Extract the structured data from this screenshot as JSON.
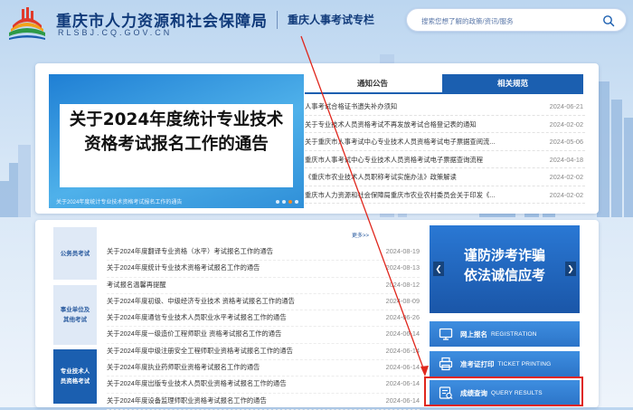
{
  "header": {
    "site_title": "重庆市人力资源和社会保障局",
    "site_url": "RLSBJ.CQ.GOV.CN",
    "section_title": "重庆人事考试专栏",
    "search_placeholder": "搜索您想了解的政策/资讯/服务"
  },
  "banner": {
    "headline": "关于2024年度统计专业技术资格考试报名工作的通告",
    "caption": "关于2024年度统计专业技术资格考试报名工作的通告"
  },
  "tabs": [
    {
      "label": "通知公告"
    },
    {
      "label": "相关规范"
    }
  ],
  "news": [
    {
      "title": "人事考试合格证书遗失补办须知",
      "date": "2024-06-21"
    },
    {
      "title": "关于专业技术人员资格考试不再发放考试合格登记表的通知",
      "date": "2024-02-02"
    },
    {
      "title": "关于重庆市人事考试中心专业技术人员资格考试电子票据查阅流...",
      "date": "2024-05-06"
    },
    {
      "title": "重庆市人事考试中心专业技术人员资格考试电子票据查询流程",
      "date": "2024-04-18"
    },
    {
      "title": "《重庆市农业技术人员职称考试实施办法》政策解读",
      "date": "2024-02-02"
    },
    {
      "title": "重庆市人力资源和社会保障局重庆市农业农村委员会关于印发《...",
      "date": "2024-02-02"
    }
  ],
  "categories": [
    {
      "label": "公务员考试"
    },
    {
      "label": "事业单位及其他考试"
    },
    {
      "label": "专业技术人员资格考试"
    }
  ],
  "more_label": "更多>>",
  "list": [
    {
      "title": "关于2024年度翻译专业资格（水平）考试报名工作的通告",
      "date": "2024-08-19"
    },
    {
      "title": "关于2024年度统计专业技术资格考试报名工作的通告",
      "date": "2024-08-13"
    },
    {
      "title": "考试报名温馨再提醒",
      "date": "2024-08-12"
    },
    {
      "title": "关于2024年度初级、中级经济专业技术 资格考试报名工作的通告",
      "date": "2024-08-09"
    },
    {
      "title": "关于2024年度通信专业技术人员职业水平考试报名工作的通告",
      "date": "2024-06-26"
    },
    {
      "title": "关于2024年度一级造价工程师职业 资格考试报名工作的通告",
      "date": "2024-06-14"
    },
    {
      "title": "关于2024年度中级注册安全工程师职业资格考试报名工作的通告",
      "date": "2024-06-14"
    },
    {
      "title": "关于2024年度执业药师职业资格考试报名工作的通告",
      "date": "2024-06-14"
    },
    {
      "title": "关于2024年度出版专业技术人员职业资格考试报名工作的通告",
      "date": "2024-06-14"
    },
    {
      "title": "关于2024年度设备监理师职业资格考试报名工作的通告",
      "date": "2024-06-14"
    }
  ],
  "promo": {
    "line1": "谨防涉考诈骗",
    "line2": "依法诚信应考"
  },
  "quick_buttons": [
    {
      "cn": "网上报名",
      "en": "REGISTRATION",
      "icon": "computer-icon"
    },
    {
      "cn": "准考证打印",
      "en": "TICKET PRINTING",
      "icon": "printer-icon"
    },
    {
      "cn": "成绩查询",
      "en": "QUERY RESULTS",
      "icon": "query-icon"
    }
  ],
  "colors": {
    "primary": "#1b5fb0",
    "highlight": "#e0261c",
    "banner_blue": "#2f8fd8"
  }
}
